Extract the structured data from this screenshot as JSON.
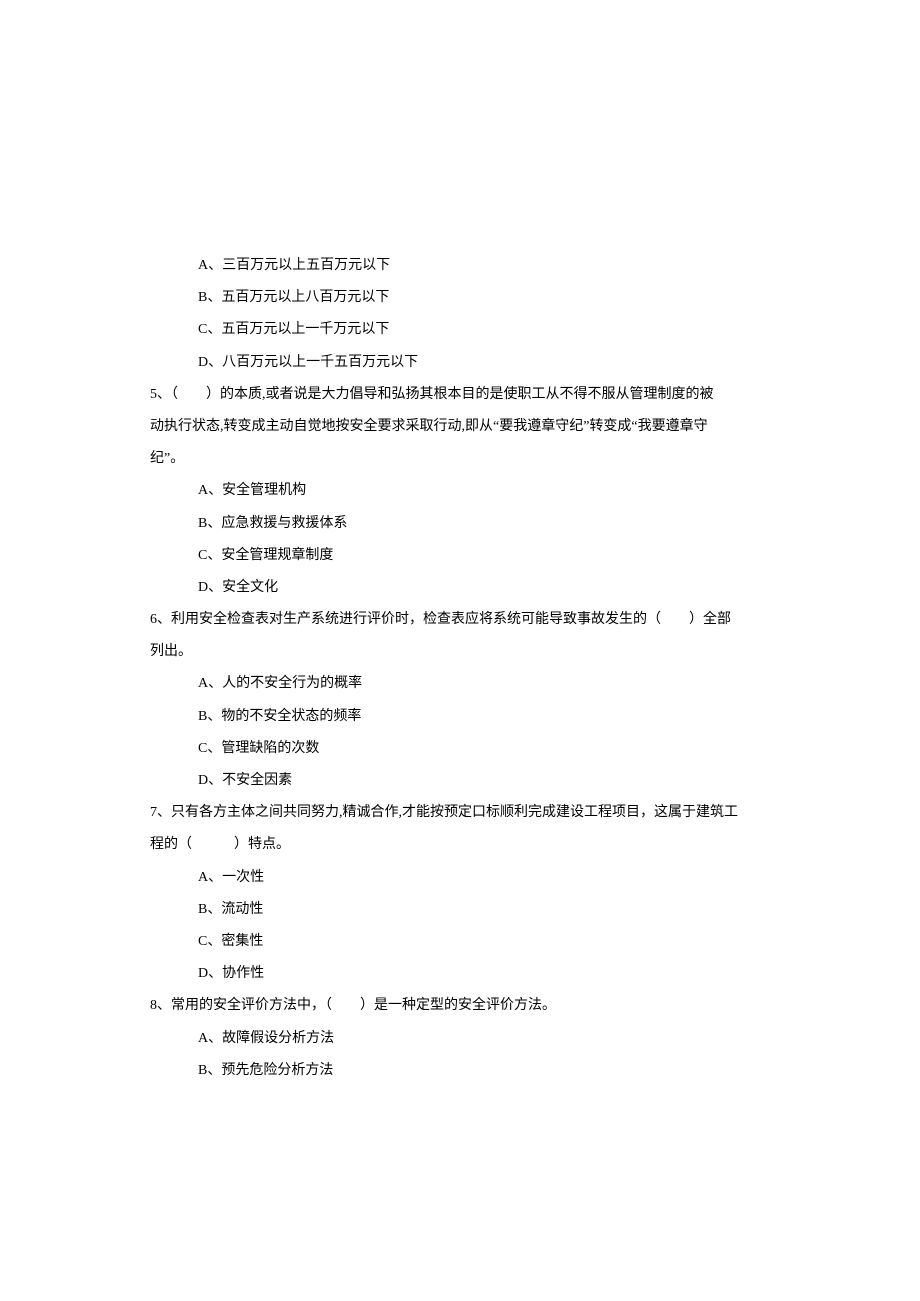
{
  "q4": {
    "options": {
      "a": "A、三百万元以上五百万元以下",
      "b": "B、五百万元以上八百万元以下",
      "c": "C、五百万元以上一千万元以下",
      "d": "D、八百万元以上一千五百万元以下"
    }
  },
  "q5": {
    "stem_l1": "5、（　　）的本质,或者说是大力倡导和弘扬其根本目的是使职工从不得不服从管理制度的被",
    "stem_l2": "动执行状态,转变成主动自觉地按安全要求采取行动,即从“要我遵章守纪”转变成“我要遵章守",
    "stem_l3": "纪”。",
    "options": {
      "a": "A、安全管理机构",
      "b": "B、应急救援与救援体系",
      "c": "C、安全管理规章制度",
      "d": "D、安全文化"
    }
  },
  "q6": {
    "stem_l1": "6、利用安全检查表对生产系统进行评价时，检查表应将系统可能导致事故发生的（　　）全部",
    "stem_l2": "列出。",
    "options": {
      "a": "A、人的不安全行为的概率",
      "b": "B、物的不安全状态的频率",
      "c": "C、管理缺陷的次数",
      "d": "D、不安全因素"
    }
  },
  "q7": {
    "stem_l1": "7、只有各方主体之间共同努力,精诚合作,才能按预定口标顺利完成建设工程项目，这属于建筑工",
    "stem_l2": "程的（　　　）特点。",
    "options": {
      "a": "A、一次性",
      "b": "B、流动性",
      "c": "C、密集性",
      "d": "D、协作性"
    }
  },
  "q8": {
    "stem_l1": "8、常用的安全评价方法中，（　　）是一种定型的安全评价方法。",
    "options": {
      "a": "A、故障假设分析方法",
      "b": "B、预先危险分析方法"
    }
  }
}
